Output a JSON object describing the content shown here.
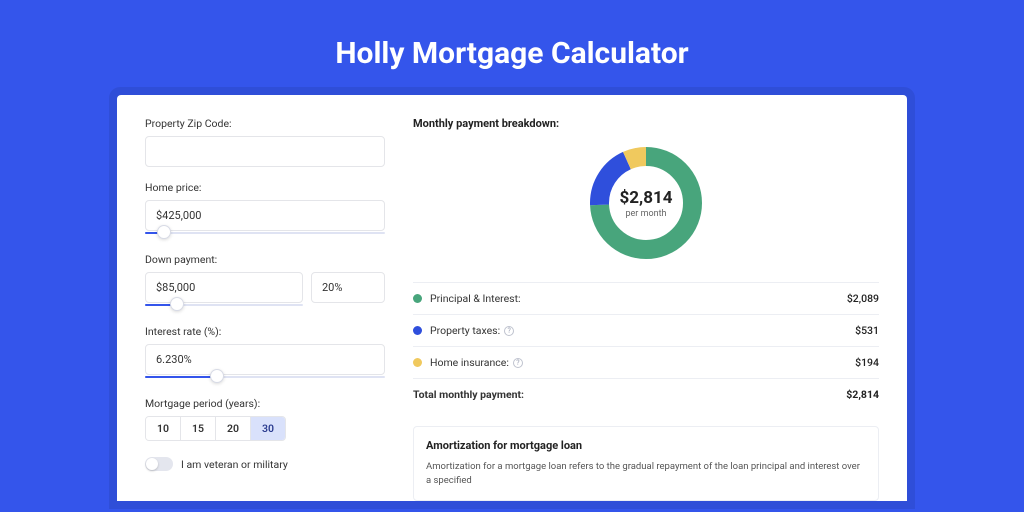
{
  "page_title": "Holly Mortgage Calculator",
  "form": {
    "zip_label": "Property Zip Code:",
    "zip_value": "",
    "home_price_label": "Home price:",
    "home_price_value": "$425,000",
    "home_price_slider_pct": 8,
    "down_payment_label": "Down payment:",
    "down_payment_value": "$85,000",
    "down_payment_pct": "20%",
    "down_payment_slider_pct": 20,
    "interest_label": "Interest rate (%):",
    "interest_value": "6.230%",
    "interest_slider_pct": 30,
    "period_label": "Mortgage period (years):",
    "period_options": [
      "10",
      "15",
      "20",
      "30"
    ],
    "period_active_index": 3,
    "veteran_label": "I am veteran or military",
    "veteran_on": false
  },
  "breakdown": {
    "title": "Monthly payment breakdown:",
    "total_value": "$2,814",
    "total_sub": "per month",
    "rows": [
      {
        "label": "Principal & Interest:",
        "value": "$2,089",
        "color": "#48a57c",
        "info": false
      },
      {
        "label": "Property taxes:",
        "value": "$531",
        "color": "#2f4fdc",
        "info": true
      },
      {
        "label": "Home insurance:",
        "value": "$194",
        "color": "#f0c95e",
        "info": true
      }
    ],
    "total_row_label": "Total monthly payment:",
    "total_row_value": "$2,814"
  },
  "chart_data": {
    "type": "pie",
    "title": "Monthly payment breakdown",
    "series": [
      {
        "name": "Principal & Interest",
        "value": 2089,
        "color": "#48a57c"
      },
      {
        "name": "Property taxes",
        "value": 531,
        "color": "#2f4fdc"
      },
      {
        "name": "Home insurance",
        "value": 194,
        "color": "#f0c95e"
      }
    ],
    "total": 2814,
    "center_label": "$2,814",
    "center_sublabel": "per month"
  },
  "amort": {
    "title": "Amortization for mortgage loan",
    "body": "Amortization for a mortgage loan refers to the gradual repayment of the loan principal and interest over a specified"
  }
}
